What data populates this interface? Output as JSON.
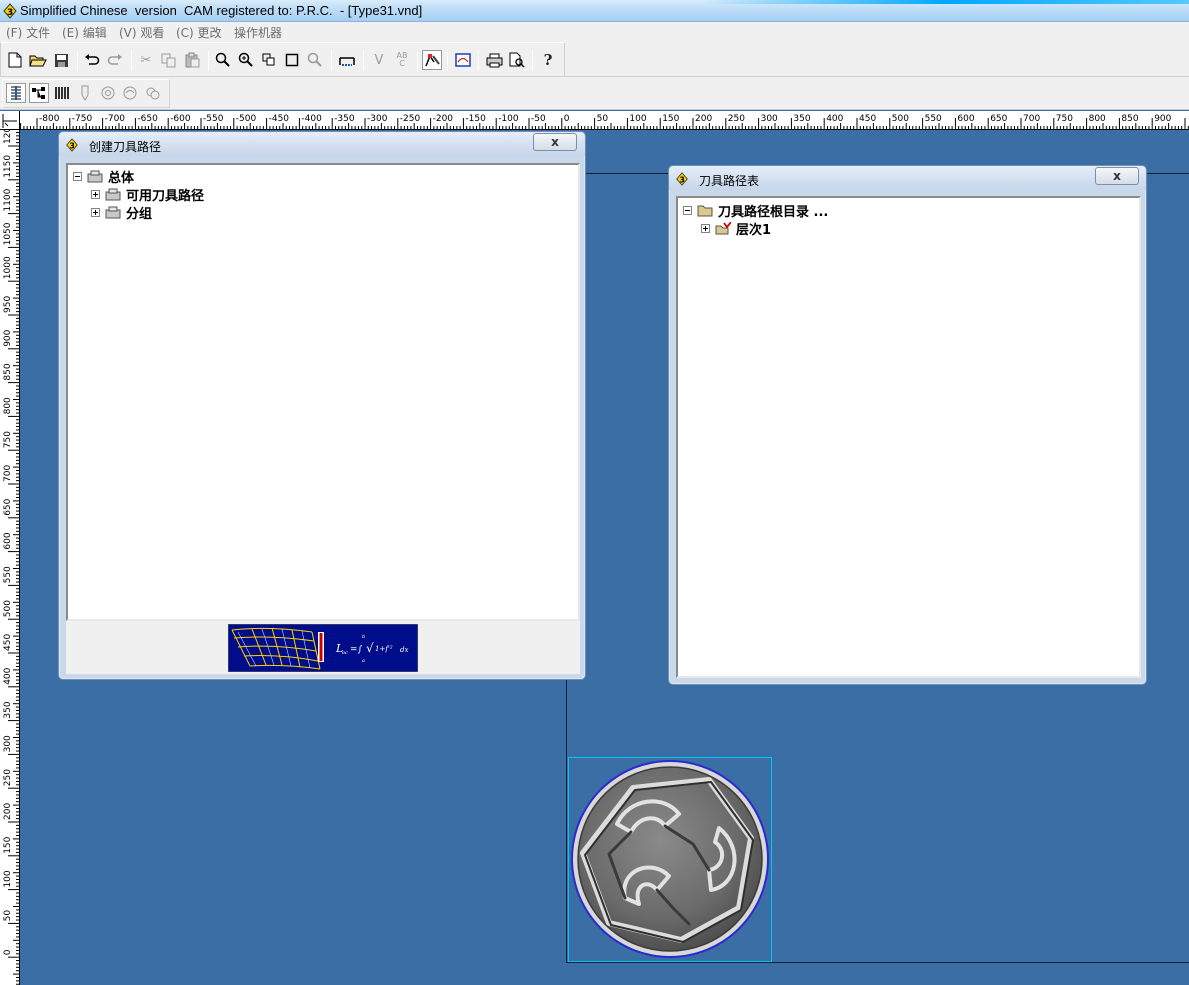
{
  "window": {
    "title": "Simplified Chinese  version  CAM registered to: P.R.C.  - [Type31.vnd]"
  },
  "menu": {
    "items": [
      {
        "label": "(F) 文件"
      },
      {
        "label": "(E) 编辑"
      },
      {
        "label": "(V) 观看"
      },
      {
        "label": "(C) 更改"
      },
      {
        "label": "操作机器"
      }
    ]
  },
  "toolbar": {
    "buttons": [
      {
        "name": "new-file-icon",
        "glyph": "🗋"
      },
      {
        "name": "open-folder-icon",
        "glyph": "📂"
      },
      {
        "name": "save-icon",
        "glyph": "💾"
      },
      {
        "name": "undo-icon",
        "glyph": "↶"
      },
      {
        "name": "redo-icon",
        "glyph": "↷"
      },
      {
        "name": "cut-icon",
        "glyph": "✂"
      },
      {
        "name": "copy-icon",
        "glyph": "⧉"
      },
      {
        "name": "paste-icon",
        "glyph": "📋"
      },
      {
        "name": "zoom-icon",
        "glyph": "🔍"
      },
      {
        "name": "zoom-in-icon",
        "glyph": "⊕"
      },
      {
        "name": "zoom-window-icon",
        "glyph": "⧉"
      },
      {
        "name": "zoom-fit-icon",
        "glyph": "□"
      },
      {
        "name": "zoom-previous-icon",
        "glyph": "⊙"
      },
      {
        "name": "measure-icon",
        "glyph": "⊓"
      },
      {
        "name": "vector-text-icon",
        "glyph": "V"
      },
      {
        "name": "abc-text-icon",
        "glyph": "ᴬᴮᶜ"
      },
      {
        "name": "node-edit-icon",
        "glyph": "✎"
      },
      {
        "name": "preview-icon",
        "glyph": "▣"
      },
      {
        "name": "print-icon",
        "glyph": "🖶"
      },
      {
        "name": "print-preview-icon",
        "glyph": "🗐"
      },
      {
        "name": "help-icon",
        "glyph": "?"
      }
    ],
    "buttons2": [
      {
        "name": "layer-stack-icon",
        "glyph": "▥"
      },
      {
        "name": "toolpath-tree-icon",
        "glyph": "⧓"
      },
      {
        "name": "tool-library-icon",
        "glyph": "⫼"
      },
      {
        "name": "tool-icon",
        "glyph": "⍊"
      },
      {
        "name": "simulate-icon",
        "glyph": "◎"
      },
      {
        "name": "simulate-2-icon",
        "glyph": "◎"
      },
      {
        "name": "simulate-3-icon",
        "glyph": "◍"
      }
    ]
  },
  "ruler": {
    "top_labels": [
      "-800",
      "-750",
      "-700",
      "-650",
      "-600",
      "-550",
      "-500",
      "-450",
      "-400",
      "-350",
      "-300",
      "-250",
      "-200",
      "-150",
      "-100",
      "-50",
      "0",
      "50",
      "100",
      "150",
      "200",
      "250",
      "300",
      "350",
      "400",
      "450",
      "500",
      "550",
      "600",
      "650",
      "700",
      "750",
      "800",
      "850",
      "900"
    ],
    "left_labels": [
      "1200",
      "1150",
      "1100",
      "1050",
      "1000",
      "950",
      "900",
      "850",
      "800",
      "750",
      "700",
      "650",
      "600",
      "550",
      "500",
      "450",
      "400",
      "350",
      "300",
      "250",
      "200",
      "150",
      "100",
      "50",
      "0"
    ]
  },
  "create_toolpath": {
    "title": "创建刀具路径",
    "close_label": "x",
    "tree": [
      {
        "label": "总体",
        "expanded": true
      },
      {
        "label": "可用刀具路径",
        "expanded": false
      },
      {
        "label": "分组",
        "expanded": false
      }
    ]
  },
  "toolpath_list": {
    "title": "刀具路径表",
    "close_label": "x",
    "tree": [
      {
        "label": "刀具路径根目录 ...",
        "expanded": true
      },
      {
        "label": "层次1",
        "expanded": false
      }
    ]
  },
  "colors": {
    "desktop": "#3b6ea5",
    "banner_bg": "#000d8a",
    "selection": "#00c8f0"
  }
}
